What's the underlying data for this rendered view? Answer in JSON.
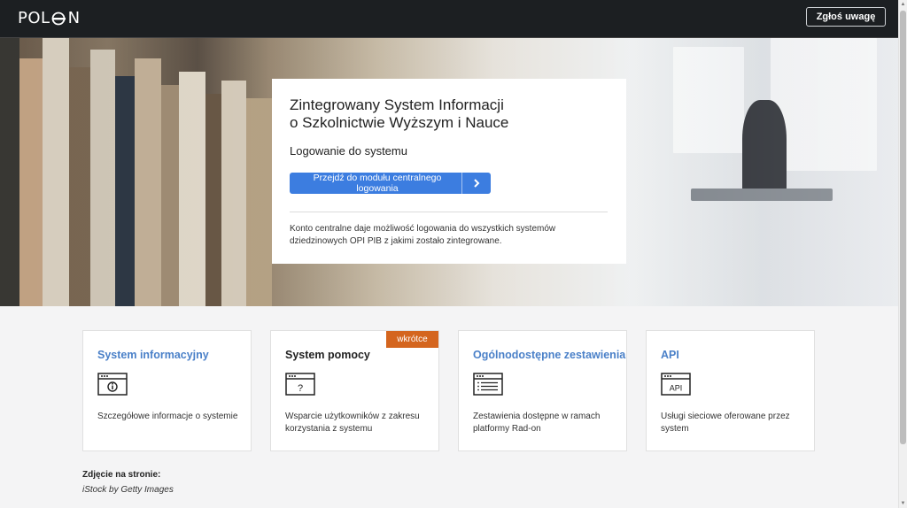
{
  "header": {
    "logo": {
      "left": "POL",
      "right": "N"
    },
    "report_button": "Zgłoś uwagę"
  },
  "login": {
    "title_line1": "Zintegrowany System Informacji",
    "title_line2": "o Szkolnictwie Wyższym i Nauce",
    "subtitle": "Logowanie do systemu",
    "button_label": "Przejdź do modułu centralnego logowania",
    "description": "Konto centralne daje możliwość logowania do wszystkich systemów dziedzinowych OPI PIB z jakimi zostało zintegrowane."
  },
  "tiles": [
    {
      "title": "System informacyjny",
      "description": "Szczegółowe informacje o systemie",
      "icon": "info-window-icon"
    },
    {
      "title": "System pomocy",
      "description": "Wsparcie użytkowników z zakresu korzystania z systemu",
      "badge": "wkrótce",
      "icon": "help-window-icon",
      "icon_glyph": "?"
    },
    {
      "title": "Ogólnodostępne zestawienia",
      "description": "Zestawienia dostępne w ramach platformy Rad-on",
      "icon": "list-window-icon"
    },
    {
      "title": "API",
      "description": "Usługi sieciowe oferowane przez system",
      "icon": "api-window-icon",
      "icon_glyph": "API"
    }
  ],
  "credit": {
    "label": "Zdjęcie na stronie:",
    "value": "iStock by Getty Images"
  },
  "colors": {
    "accent": "#3c7de0",
    "link": "#4a80c8",
    "badge": "#d4651e",
    "topbar": "#1c1f22"
  }
}
